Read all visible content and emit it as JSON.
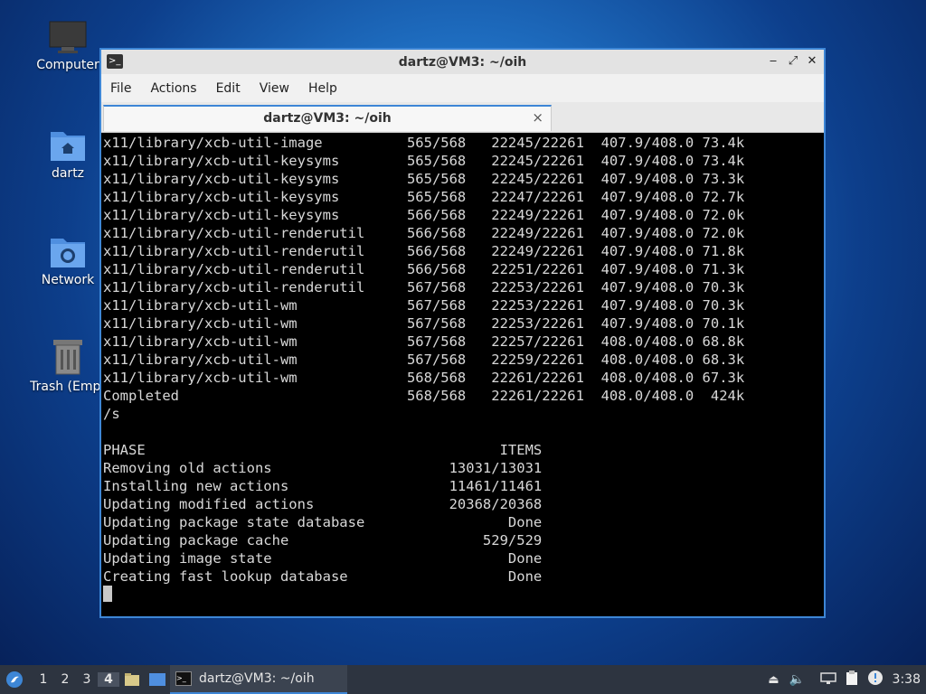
{
  "desktop": {
    "icons": [
      {
        "label": "Computer"
      },
      {
        "label": "dartz"
      },
      {
        "label": "Network"
      },
      {
        "label": "Trash (Empt"
      }
    ]
  },
  "window": {
    "title": "dartz@VM3: ~/oih",
    "menu": [
      "File",
      "Actions",
      "Edit",
      "View",
      "Help"
    ],
    "tab_title": "dartz@VM3: ~/oih",
    "tab_close": "×"
  },
  "terminal": {
    "lines": [
      "x11/library/xcb-util-image          565/568   22245/22261  407.9/408.0 73.4k",
      "x11/library/xcb-util-keysyms        565/568   22245/22261  407.9/408.0 73.4k",
      "x11/library/xcb-util-keysyms        565/568   22245/22261  407.9/408.0 73.3k",
      "x11/library/xcb-util-keysyms        565/568   22247/22261  407.9/408.0 72.7k",
      "x11/library/xcb-util-keysyms        566/568   22249/22261  407.9/408.0 72.0k",
      "x11/library/xcb-util-renderutil     566/568   22249/22261  407.9/408.0 72.0k",
      "x11/library/xcb-util-renderutil     566/568   22249/22261  407.9/408.0 71.8k",
      "x11/library/xcb-util-renderutil     566/568   22251/22261  407.9/408.0 71.3k",
      "x11/library/xcb-util-renderutil     567/568   22253/22261  407.9/408.0 70.3k",
      "x11/library/xcb-util-wm             567/568   22253/22261  407.9/408.0 70.3k",
      "x11/library/xcb-util-wm             567/568   22253/22261  407.9/408.0 70.1k",
      "x11/library/xcb-util-wm             567/568   22257/22261  408.0/408.0 68.8k",
      "x11/library/xcb-util-wm             567/568   22259/22261  408.0/408.0 68.3k",
      "x11/library/xcb-util-wm             568/568   22261/22261  408.0/408.0 67.3k",
      "Completed                           568/568   22261/22261  408.0/408.0  424k",
      "/s",
      "",
      "PHASE                                          ITEMS",
      "Removing old actions                     13031/13031",
      "Installing new actions                   11461/11461",
      "Updating modified actions                20368/20368",
      "Updating package state database                 Done",
      "Updating package cache                       529/529",
      "Updating image state                            Done",
      "Creating fast lookup database                   Done"
    ]
  },
  "taskbar": {
    "workspaces": [
      "1",
      "2",
      "3",
      "4"
    ],
    "active_workspace": "4",
    "task_title": "dartz@VM3: ~/oih",
    "clock": "3:38"
  },
  "colors": {
    "accent": "#3d86d6",
    "terminal_bg": "#000000",
    "terminal_fg": "#d8d8d8",
    "panel_bg": "#2d3440"
  }
}
